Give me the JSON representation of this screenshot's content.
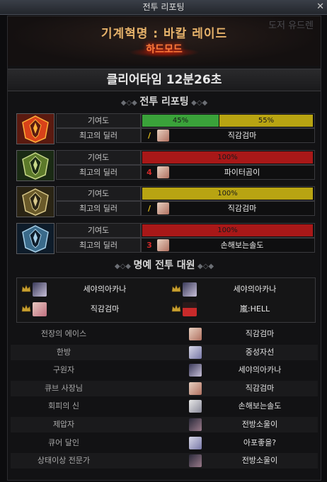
{
  "window": {
    "title": "전투 리포팅",
    "close": "✕"
  },
  "header": {
    "raid_name": "기계혁명 : 바칼 레이드",
    "difficulty": "하드모드",
    "bg_text": "도저 유드렌"
  },
  "clear_time": "클리어타임  12분26초",
  "section_report": "전투 리포팅",
  "section_honor": "명예 전투 대원",
  "labels": {
    "contribution": "기여도",
    "best_dealer": "최고의 딜러"
  },
  "parties": [
    {
      "icon": "red-crest-icon",
      "bars": [
        {
          "value": "45%",
          "pct": 45,
          "color": "#3aa23a"
        },
        {
          "value": "55%",
          "pct": 55,
          "color": "#b8a412"
        }
      ],
      "rank": "/",
      "rank_color": "#e8c21a",
      "dealer": "직감검마"
    },
    {
      "icon": "green-crest-icon",
      "bars": [
        {
          "value": "100%",
          "pct": 100,
          "color": "#a81818"
        }
      ],
      "rank": "4",
      "rank_color": "#d42a2a",
      "dealer": "파이터곰이"
    },
    {
      "icon": "gold-crest-icon",
      "bars": [
        {
          "value": "100%",
          "pct": 100,
          "color": "#b8a412"
        }
      ],
      "rank": "/",
      "rank_color": "#e8c21a",
      "dealer": "직감검마"
    },
    {
      "icon": "blue-crest-icon",
      "bars": [
        {
          "value": "100%",
          "pct": 100,
          "color": "#a81818"
        }
      ],
      "rank": "3",
      "rank_color": "#d42a2a",
      "dealer": "손해보는솔도"
    }
  ],
  "honor": [
    {
      "name": "세야의아카나"
    },
    {
      "name": "세야의아카나"
    },
    {
      "name": "직감검마"
    },
    {
      "name": "嵐:HELL"
    }
  ],
  "awards": [
    {
      "title": "전장의 에이스",
      "name": "직감검마"
    },
    {
      "title": "한방",
      "name": "중성자선"
    },
    {
      "title": "구원자",
      "name": "세야의아카나"
    },
    {
      "title": "큐브 사장님",
      "name": "직감검마"
    },
    {
      "title": "회피의 신",
      "name": "손해보는솔도"
    },
    {
      "title": "제압자",
      "name": "전방소울이"
    },
    {
      "title": "큐어 달인",
      "name": "아포좋을?"
    },
    {
      "title": "상태이상 전문가",
      "name": "전방소울이"
    }
  ]
}
